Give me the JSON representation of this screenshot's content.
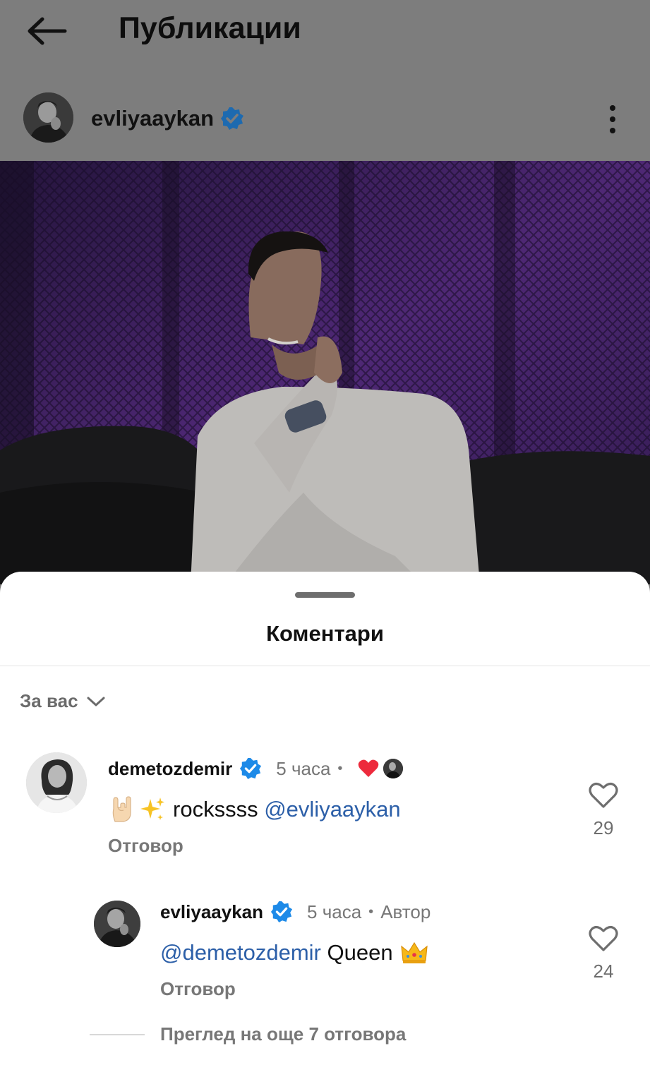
{
  "header": {
    "title": "Публикации",
    "back_icon": "arrow-left-icon"
  },
  "post": {
    "username": "evliyaaykan",
    "verified": true,
    "more_icon": "more-vertical-icon"
  },
  "comments_sheet": {
    "title": "Коментари",
    "sort_label": "За вас",
    "sort_icon": "chevron-down-icon",
    "view_more_replies": "Преглед на още 7 отговора",
    "comments": [
      {
        "username": "demetozdemir",
        "time": "5 часа",
        "separator": "•",
        "text": "rockssss",
        "mention": "@evliyaaykan",
        "emojis": [
          "horns-emoji",
          "sparkles-emoji"
        ],
        "liked_by_author": true,
        "reply_label": "Отговор",
        "likes": "29"
      },
      {
        "username": "evliyaaykan",
        "time": "5 часа",
        "separator": "•",
        "badge": "Автор",
        "mention": "@demetozdemir",
        "text": "Queen",
        "emojis": [
          "crown-emoji"
        ],
        "reply_label": "Отговор",
        "likes": "24"
      }
    ]
  },
  "colors": {
    "overlay_gray": "#7d7d7d",
    "mention_blue": "#2c5fa8",
    "verified_blue": "#1d8ae8",
    "heart_red": "#ed2a3c"
  }
}
